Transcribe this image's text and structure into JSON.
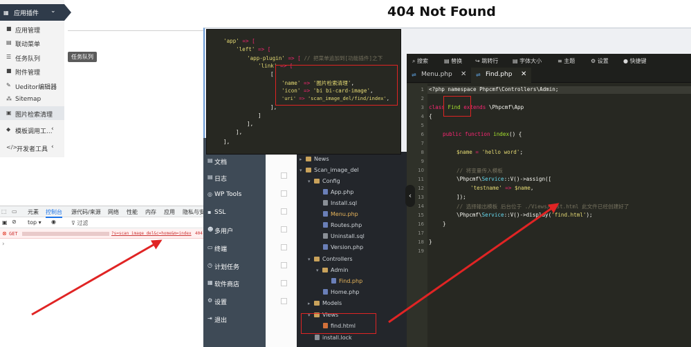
{
  "page": {
    "title": "404 Not Found"
  },
  "sidebar": {
    "header": "应用插件",
    "items": [
      {
        "label": "应用管理",
        "icon": "folder-icon"
      },
      {
        "label": "联动菜单",
        "icon": "list-icon"
      },
      {
        "label": "任务队列",
        "icon": "list-icon"
      },
      {
        "label": "附件管理",
        "icon": "folder-icon"
      },
      {
        "label": "Ueditor编辑器",
        "icon": "edit-icon"
      },
      {
        "label": "Sitemap",
        "icon": "sitemap-icon"
      },
      {
        "label": "图片检索清理",
        "icon": "image-icon"
      },
      {
        "label": "模板调用工...",
        "icon": "tag-icon"
      },
      {
        "label": "开发者工具",
        "icon": "code-icon"
      }
    ],
    "tooltip": "任务队列"
  },
  "devtools": {
    "tabs": [
      "元素",
      "控制台",
      "源代码/来源",
      "网络",
      "性能",
      "内存",
      "应用",
      "隐私与安"
    ],
    "context": "top",
    "filter": "过滤",
    "error_prefix": "GET",
    "error_url": "?s=scan_image_del&c=home&m=index",
    "error_code": "404"
  },
  "cms_menu": [
    "文档",
    "日志",
    "WP Tools",
    "SSL",
    "多用户",
    "终端",
    "计划任务",
    "软件商店",
    "设置",
    "退出"
  ],
  "file_tree": [
    {
      "label": "News",
      "type": "folder",
      "depth": 0,
      "open": false
    },
    {
      "label": "Scan_image_del",
      "type": "folder",
      "depth": 0,
      "open": true
    },
    {
      "label": "Config",
      "type": "folder",
      "depth": 1,
      "open": true
    },
    {
      "label": "App.php",
      "type": "php",
      "depth": 2
    },
    {
      "label": "Install.sql",
      "type": "sql",
      "depth": 2
    },
    {
      "label": "Menu.php",
      "type": "php",
      "depth": 2,
      "highlight": true
    },
    {
      "label": "Routes.php",
      "type": "php",
      "depth": 2
    },
    {
      "label": "Uninstall.sql",
      "type": "sql",
      "depth": 2
    },
    {
      "label": "Version.php",
      "type": "php",
      "depth": 2
    },
    {
      "label": "Controllers",
      "type": "folder",
      "depth": 1,
      "open": true
    },
    {
      "label": "Admin",
      "type": "folder",
      "depth": 2,
      "open": true
    },
    {
      "label": "Find.php",
      "type": "php",
      "depth": 3,
      "highlight": true
    },
    {
      "label": "Home.php",
      "type": "php",
      "depth": 2
    },
    {
      "label": "Models",
      "type": "folder",
      "depth": 1,
      "open": false
    },
    {
      "label": "Views",
      "type": "folder",
      "depth": 1,
      "open": true
    },
    {
      "label": "find.html",
      "type": "html",
      "depth": 2
    },
    {
      "label": "install.lock",
      "type": "lock",
      "depth": 1
    }
  ],
  "editor": {
    "toolbar": [
      "搜索",
      "替换",
      "跳转行",
      "字体大小",
      "主题",
      "设置",
      "快捷键"
    ],
    "tabs": [
      {
        "label": "Menu.php",
        "active": false
      },
      {
        "label": "Find.php",
        "active": true
      }
    ]
  },
  "code": {
    "l1": "<?php namespace Phpcmf\\Controllers\\Admin;",
    "l3a": "class ",
    "l3b": "Find",
    "l3c": " extends ",
    "l3d": "\\Phpcmf\\App",
    "l4": "{",
    "l6a": "public function ",
    "l6b": "index",
    "l6c": "() {",
    "l8a": "$name",
    "l8b": " = ",
    "l8c": "'hello word'",
    "l8d": ";",
    "l10": "// 将变量传入模板",
    "l11a": "\\Phpcmf\\",
    "l11b": "Service",
    "l11c": "::V()->assign([",
    "l12a": "'testname'",
    "l12b": " => ",
    "l12c": "$name",
    "l12d": ",",
    "l13": "]);",
    "l14": "// 选择输出模板 后台位于 ./Views/test.html 此文件已经创建好了",
    "l15a": "\\Phpcmf\\",
    "l15b": "Service",
    "l15c": "::V()->display(",
    "l15d": "'find.html'",
    "l15e": ");",
    "l16": "}",
    "l18": "}"
  },
  "snippet": {
    "s1a": "'app'",
    "s1b": " => [",
    "s2a": "'left'",
    "s2b": " => [",
    "s3a": "'app-plugin'",
    "s3b": " => [ ",
    "s3c": "// 把菜单追加到[功能插件]之下",
    "s4a": "'link'",
    "s4b": " => [",
    "s5": "[",
    "s6a": "'name'",
    "s6b": " => ",
    "s6c": "'图片检索清理'",
    "s6d": ",",
    "s7a": "'icon'",
    "s7b": " => ",
    "s7c": "'bi bi-card-image'",
    "s7d": ",",
    "s8a": "'uri'",
    "s8b": " => ",
    "s8c": "'scan_image_del/find/index'",
    "s8d": ",",
    "s9": "],",
    "s10": "]",
    "s11": "],",
    "s12": "],",
    "s13": "],"
  },
  "colors": {
    "annotation": "#e02424",
    "editor_bg": "#272822",
    "sidebar_header": "#2f3b4a"
  }
}
